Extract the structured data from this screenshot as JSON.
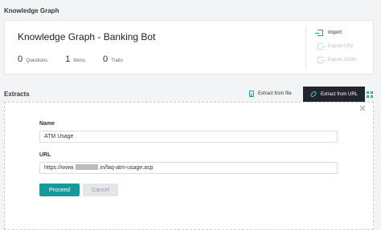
{
  "header": {
    "title": "Knowledge Graph"
  },
  "kg": {
    "name": "Knowledge Graph - Banking Bot",
    "stats": [
      {
        "value": "0",
        "label": "Questions"
      },
      {
        "value": "1",
        "label": "Items"
      },
      {
        "value": "0",
        "label": "Traits"
      }
    ],
    "actions": [
      {
        "label": "Import",
        "icon": "import-icon",
        "enabled": true
      },
      {
        "label": "Export CSV",
        "icon": "export-icon",
        "enabled": false
      },
      {
        "label": "Export JSON",
        "icon": "export-icon",
        "enabled": false
      }
    ]
  },
  "extracts": {
    "title": "Extracts",
    "from_file_label": "Extract from file",
    "from_url_label": "Extract from URL"
  },
  "form": {
    "name_label": "Name",
    "name_value": "ATM Usage",
    "url_label": "URL",
    "url_prefix": "https://www.",
    "url_suffix": ".in/faq-atm-usage.asp",
    "proceed_label": "Proceed",
    "cancel_label": "Cancel"
  },
  "colors": {
    "accent": "#159a9c",
    "dark_button": "#22252e",
    "disabled_text": "#b5b9bf"
  }
}
